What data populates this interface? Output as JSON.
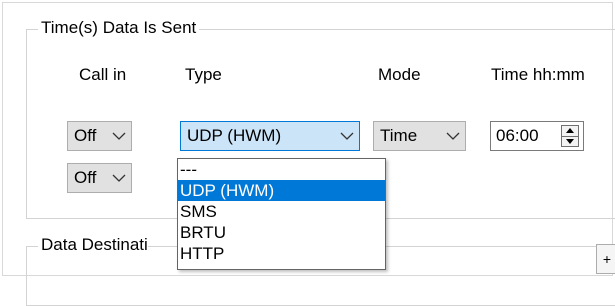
{
  "group_time": {
    "title": "Time(s) Data Is Sent"
  },
  "columns": {
    "call_in": "Call in",
    "type": "Type",
    "mode": "Mode",
    "time": "Time hh:mm"
  },
  "row1": {
    "call_in_value": "Off",
    "type_value": "UDP (HWM)",
    "mode_value": "Time",
    "time_value": "06:00"
  },
  "row2": {
    "call_in_value": "Off"
  },
  "type_dropdown": {
    "options": [
      "---",
      "UDP (HWM)",
      "SMS",
      "BRTU",
      "HTTP"
    ],
    "selected": "UDP (HWM)"
  },
  "group_destination": {
    "title": "Data Destinati"
  },
  "plus_button": {
    "label": "+"
  },
  "colors": {
    "selection": "#0078d7",
    "focus_bg": "#cce4f7"
  }
}
